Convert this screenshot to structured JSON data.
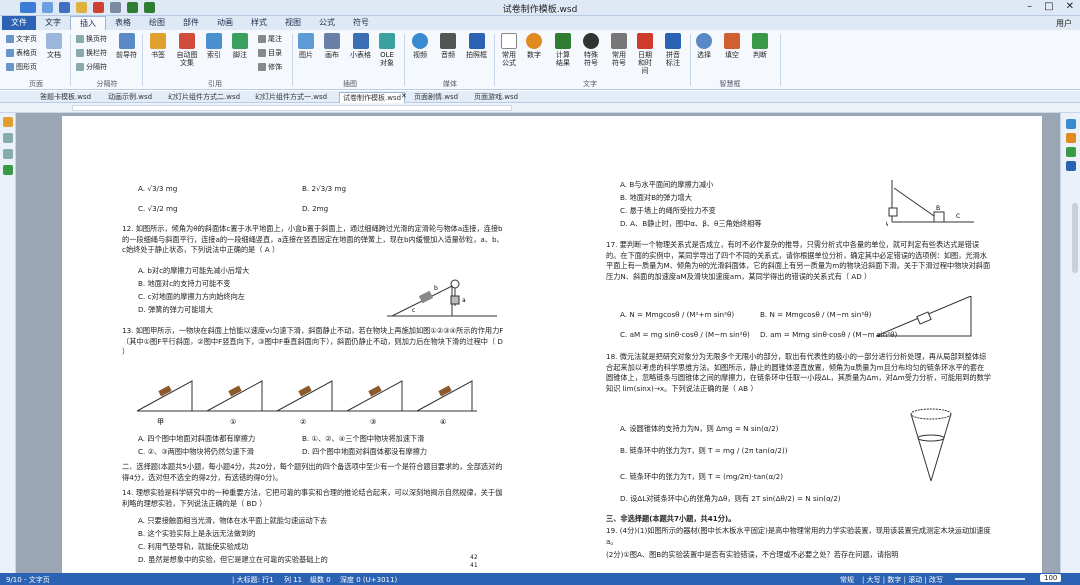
{
  "window": {
    "title": "试卷制作模板.wsd",
    "user": "用户"
  },
  "menu_tabs": [
    "文件",
    "文字",
    "插入",
    "表格",
    "绘图",
    "部件",
    "动画",
    "样式",
    "视图",
    "公式",
    "符号"
  ],
  "active_tab": "插入",
  "ribbon": {
    "page_group": {
      "label": "页面",
      "items": [
        "文字页",
        "表格页",
        "图形页",
        "文档"
      ]
    },
    "section_group": {
      "label": "分隔符",
      "items": [
        "换页符",
        "换栏符",
        "分隔符",
        "前导符"
      ]
    },
    "ref_group": {
      "label": "引用",
      "items": [
        "书签",
        "自动图文集",
        "索引",
        "脚注",
        "尾注",
        "目录",
        "修饰"
      ]
    },
    "illus_group": {
      "label": "插图",
      "items": [
        "图片",
        "画布",
        "小表格",
        "OLE对象"
      ]
    },
    "media_group": {
      "label": "媒体",
      "items": [
        "视频",
        "音频",
        "拍照框"
      ]
    },
    "text_group": {
      "label": "文字",
      "items": [
        "常用公式",
        "数字",
        "计算结果",
        "特殊符号",
        "常用符号",
        "日期和时间",
        "拼音标注"
      ]
    },
    "smart_group": {
      "label": "智慧框",
      "items": [
        "选择",
        "填空",
        "判断"
      ]
    }
  },
  "doc_tabs": [
    "答题卡模板.wsd",
    "动画示例.wsd",
    "幻灯片组件方式二.wsd",
    "幻灯片组件方式一.wsd",
    "试卷制作模板.wsd",
    "页面剧情.wsd",
    "页面游戏.wsd"
  ],
  "active_doc_tab": "试卷制作模板.wsd",
  "page1": {
    "opt_A": "A. √3/3 mg",
    "opt_B": "B. 2√3/3 mg",
    "opt_C": "C. √3/2 mg",
    "opt_D": "D. 2mg",
    "q12": "12. 如图所示，倾角为θ的斜面体c置于水平地面上，小盒b置于斜面上，通过细绳跨过光滑的定滑轮与物体a连接，连接b的一段细绳与斜面平行，连接a的一段细绳竖直，a连接在竖直固定在地面的弹簧上，现在b内缓慢加入适量砂粒，a、b、c始终处于静止状态，下列说法中正确的是（ A ）",
    "q12_A": "A. b对c的摩擦力可能先减小后增大",
    "q12_B": "B. 地面对c的支持力可能不变",
    "q12_C": "C. c对地面的摩擦力方向始终向左",
    "q12_D": "D. 弹簧的弹力可能增大",
    "q13": "13. 如图甲所示，一物块在斜面上恰能以速度v₀匀速下滑，斜面静止不动，若在物块上再施加如图①②③④所示的作用力F（其中①图F平行斜面，②图中F竖直向下，③图中F垂直斜面向下），斜面仍静止不动，则加力后在物块下滑的过程中（ D ）",
    "fig_labels": [
      "甲",
      "①",
      "②",
      "③",
      "④"
    ],
    "q13_A": "A. 四个图中地面对斜面体都有摩擦力",
    "q13_B": "B. ①、②、④三个图中物块将加速下滑",
    "q13_C": "C. ②、③两图中物块将仍然匀速下滑",
    "q13_D": "D. 四个图中地面对斜面体都没有摩擦力",
    "section2": "二、选择题(本题共5小题，每小题4分，共20分，每个题列出的四个备选项中至少有一个是符合题目要求的，全部选对的得4分，选对但不选全的得2分，有选错的得0分)。",
    "q14": "14. 理想实验是科学研究中的一种重要方法，它把可靠的事实和合理的推论结合起来，可以深刻地揭示自然规律，关于伽利略的理想实验，下列说法正确的是（ BD ）",
    "q14_A": "A. 只要接触面相当光滑，物体在水平面上就能匀速运动下去",
    "q14_B": "B. 这个实验实际上是永远无法做到的",
    "q14_C": "C. 利用气垫导轨，就能使实验成功",
    "q14_D": "D. 虽然是想象中的实验，但它是建立在可靠的实验基础上的",
    "page_no_a": "42",
    "page_no_b": "41"
  },
  "page2": {
    "top_A": "A. B与水平面间的摩擦力减小",
    "top_B": "B. 地面对B的弹力增大",
    "top_C": "C. 悬于墙上的绳所受拉力不变",
    "top_D": "D. A、B静止时，图中α、β、θ三角始终相等",
    "fig_labels": [
      "A",
      "B",
      "C"
    ],
    "q17": "17. 要判断一个物理关系式是否成立，有时不必作复杂的推导，只需分析式中各量的单位，就可判定有些表达式是错误的。在下面的实例中，某同学导出了四个不同的关系式，请你根据单位分析，确定其中必定错误的选项例：如图，光滑水平面上有一质量为M、倾角为θ的光滑斜面体，它的斜面上有另一质量为m的物块沿斜面下滑。关于下滑过程中物块对斜面压力N、斜面的加速度aM及滑块加速度am，某同学得出的错误的关系式有（ AD ）",
    "q17_A": "A. N = Mmgcosθ / (M²+m sin²θ)",
    "q17_B": "B. N = Mmgcosθ / (M−m sin²θ)",
    "q17_C": "C. aM = mg sinθ·cosθ / (M−m sin²θ)",
    "q17_D": "D. am = Mmg sinθ·cosθ / (M−m sin²θ)",
    "q18": "18. 微元法就是把研究对象分为无限多个无限小的部分，取出有代表性的极小的一部分进行分析处理，再从局部到整体综合起来加以考虑的科学思维方法。如图所示，静止的圆锥体竖直放置，倾角为α质量为m且分布均匀的链条环水平的套在圆锥体上，忽略链条与圆锥体之间的摩擦力，在链条环中任取一小段ΔL，其质量为Δm，对Δm受力分析，可能用到的数学知识 lim(sinx)→x。下列说法正确的是（ AB ）",
    "q18_A": "A. 设圆锥体的支持力为N，则 Δmg = N sin(α/2)",
    "q18_B": "B. 链条环中的张力为T，则 T = mg / (2π tan(α/2))",
    "q18_C": "C. 链条环中的张力为T，则 T = (mg/2π)·tan(α/2)",
    "q18_D": "D. 设ΔL对链条环中心的张角为Δθ，则有 2T sin(Δθ/2) = N sin(α/2)",
    "section3": "三、非选择题(本题共7小题，共41分)。",
    "q19": "19. (4分)(1)如图所示的器材(图中长木板水平固定)是高中物理常用的力学实验装置，现用该装置完成测定木块运动加速度a。",
    "q19b": "(2分)①图A、图B的实验装置中是否有实验错误，不合理或不必要之处？若存在问题，请指明"
  },
  "status": {
    "page": "9/10 - 文字页",
    "cursor": "| 大标题: 行1",
    "col": "列 11",
    "level": "级数 0",
    "depth": "深度 0 (U+3011)",
    "mode": "常规",
    "ind": "| 大写 | 数字 | 滚动 | 改写",
    "zoom": "100"
  },
  "colors": {
    "accent": "#2b62b4",
    "highlight": "#7a2ab8"
  }
}
